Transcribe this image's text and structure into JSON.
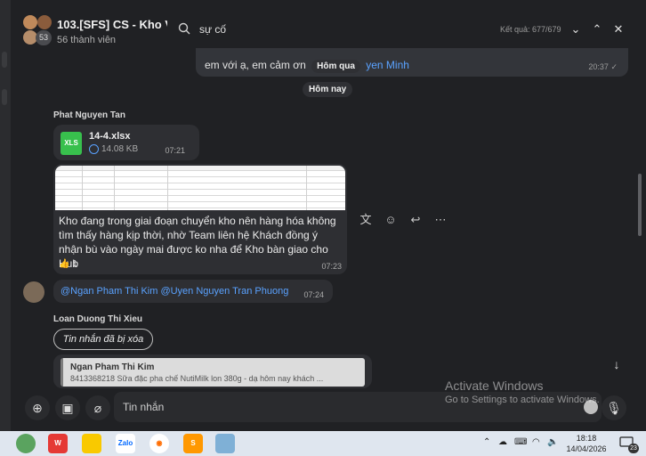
{
  "header": {
    "title": "103.[SFS] CS - Kho Vận",
    "member_count": "56 thành viên",
    "avatar_badge": "53"
  },
  "search": {
    "query": "sự cố",
    "result_label": "Kết quả: 677/679"
  },
  "messages": {
    "previous": {
      "text_before": "em với ạ, em cảm ơn",
      "day_pill": "Hôm qua",
      "link_text": "yen Minh",
      "time": "20:37"
    },
    "today_pill": "Hôm nay",
    "phat": {
      "sender": "Phat Nguyen Tan",
      "file_name": "14-4.xlsx",
      "file_size": "14.08 KB",
      "file_time": "07:21",
      "file_icon_label": "XLS",
      "body": "Kho đang trong giai đoạn chuyển kho nên hàng hóa không tìm thấy hàng kịp thời, nhờ Team liên hệ Khách đồng ý nhận bù vào ngày mai được ko nha để Kho bàn giao cho Hub",
      "reaction": "👍 1",
      "time": "07:23"
    },
    "mention": {
      "text": "@Ngan Pham Thi Kim  @Uyen Nguyen Tran Phuong",
      "time": "07:24"
    },
    "loan": {
      "sender": "Loan Duong Thi Xieu",
      "deleted_label": "Tin nhắn đã bị xóa",
      "reply_name": "Ngan Pham Thi Kim",
      "reply_text": "8413368218 Sữa đặc pha chế NutiMilk lon 380g - dạ hôm nay khách ..."
    }
  },
  "composer": {
    "placeholder": "Tin nhắn"
  },
  "watermark": {
    "line1": "Activate Windows",
    "line2": "Go to Settings to activate Windows."
  },
  "taskbar": {
    "time": "18:18",
    "date": "14/04/2026",
    "notification_count": "23",
    "apps": [
      "app-icon",
      "wps-icon",
      "sticky-notes-icon",
      "zalo-icon",
      "browser-icon",
      "sublime-icon",
      "notepad-icon"
    ]
  },
  "colors": {
    "background": "#202124",
    "bubble": "#2e2f33",
    "link": "#5aa2ff",
    "excel_green": "#38c04d",
    "taskbar": "#dfe6ef"
  }
}
